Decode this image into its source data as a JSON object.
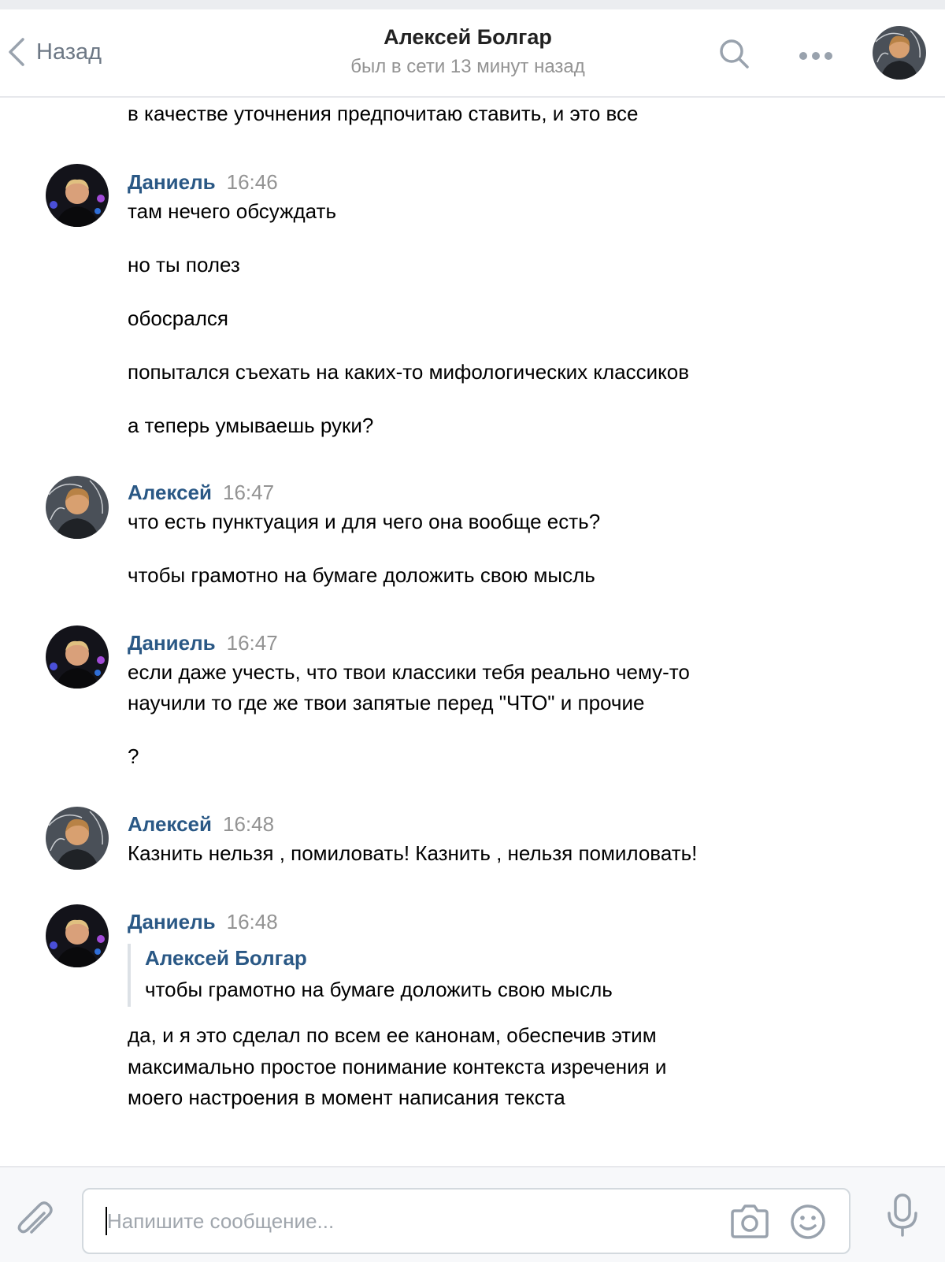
{
  "header": {
    "back_label": "Назад",
    "title": "Алексей Болгар",
    "subtitle": "был в сети 13 минут назад",
    "search_icon": "search-icon",
    "more_icon": "more-icon"
  },
  "messages": {
    "partial_text": "в качестве уточнения предпочитаю ставить, и это все",
    "groups": [
      {
        "author": "Даниель",
        "time": "16:46",
        "lines": [
          "там нечего обсуждать",
          "но ты полез",
          "обосрался",
          "попытался съехать на каких-то мифологических классиков",
          "а теперь умываешь руки?"
        ]
      },
      {
        "author": "Алексей",
        "time": "16:47",
        "lines": [
          "что есть пунктуация и для чего она вообще есть?",
          "чтобы грамотно на бумаге доложить свою мысль"
        ]
      },
      {
        "author": "Даниель",
        "time": "16:47",
        "lines": [
          "если даже учесть, что твои классики тебя реально чему-то",
          "научили то где же твои запятые перед \"ЧТО\" и прочие",
          "?"
        ]
      },
      {
        "author": "Алексей",
        "time": "16:48",
        "lines": [
          "Казнить нельзя , помиловать! Казнить , нельзя помиловать!"
        ]
      },
      {
        "author": "Даниель",
        "time": "16:48",
        "quote": {
          "author": "Алексей Болгар",
          "text": "чтобы грамотно на бумаге доложить свою мысль"
        },
        "lines": [
          "да, и я это сделал по всем ее канонам, обеспечив этим",
          "максимально простое понимание контекста изречения и",
          "моего настроения в момент написания текста"
        ]
      }
    ]
  },
  "composer": {
    "placeholder": "Напишите сообщение...",
    "value": "",
    "attach_icon": "paperclip-icon",
    "camera_icon": "camera-icon",
    "emoji_icon": "smile-icon",
    "mic_icon": "microphone-icon"
  },
  "colors": {
    "link": "#2a5885",
    "muted": "#939393",
    "icon": "#99a2ad",
    "border": "#e7e8ec"
  }
}
